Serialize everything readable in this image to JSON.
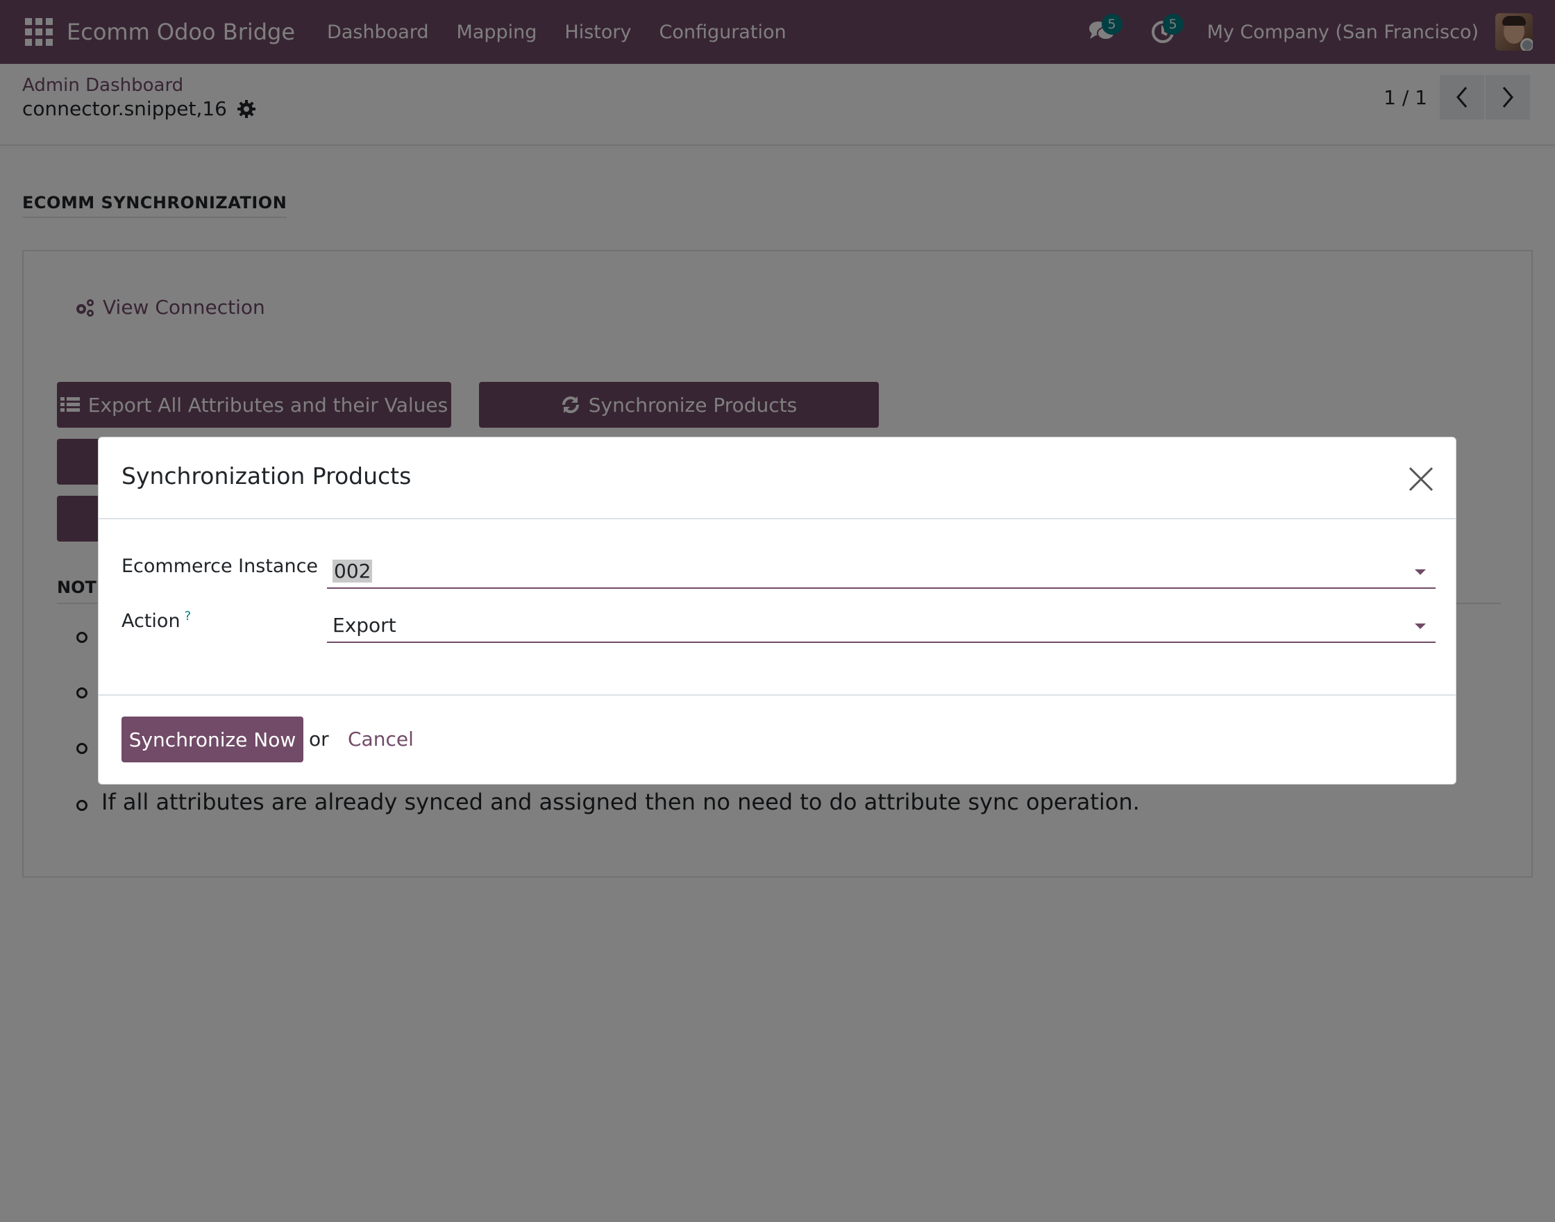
{
  "colors": {
    "brand": "#714b67",
    "badge": "#017e84",
    "overlay": "rgba(0,0,0,0.5)"
  },
  "navbar": {
    "app_icon": "apps-grid-icon",
    "brand": "Ecomm Odoo Bridge",
    "menu": [
      {
        "label": "Dashboard"
      },
      {
        "label": "Mapping"
      },
      {
        "label": "History"
      },
      {
        "label": "Configuration"
      }
    ],
    "messages_badge": "5",
    "activities_badge": "5",
    "company": "My Company (San Francisco)"
  },
  "control_panel": {
    "breadcrumb": "Admin Dashboard",
    "record_name": "connector.snippet,16",
    "pager": "1 / 1"
  },
  "sheet": {
    "section_title": "ECOMM SYNCHRONIZATION",
    "view_connection": "View Connection",
    "buttons": {
      "export_attributes": "Export All Attributes and their Values",
      "sync_products": "Synchronize Products"
    },
    "notes_title": "NOTI",
    "notes": [
      "If all attributes are already synced and assigned then no need to do attribute sync operation."
    ]
  },
  "dialog": {
    "title": "Synchronization Products",
    "fields": {
      "instance_label": "Ecommerce Instance",
      "instance_value": "002",
      "action_label": "Action",
      "action_help": "?",
      "action_value": "Export"
    },
    "footer": {
      "primary": "Synchronize Now",
      "or": "or",
      "cancel": "Cancel"
    }
  }
}
